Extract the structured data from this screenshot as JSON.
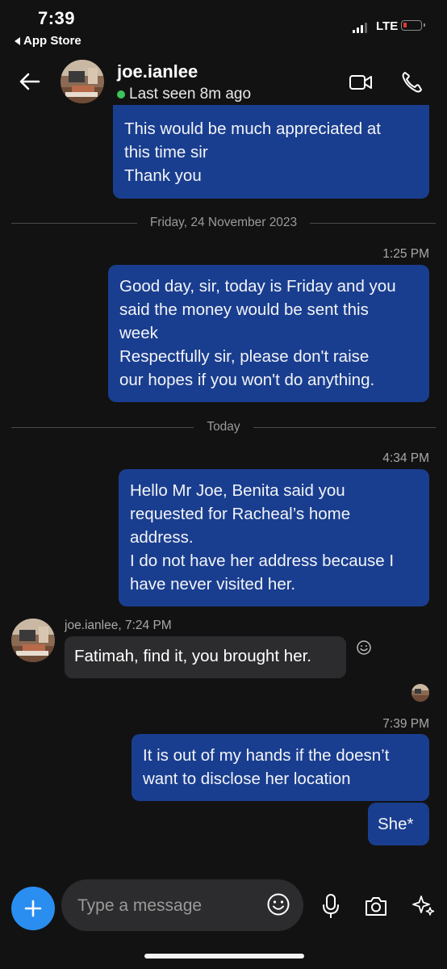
{
  "status_bar": {
    "time": "7:39",
    "back_app": "App Store",
    "network": "LTE",
    "battery_color": "#e53935"
  },
  "header": {
    "contact_name": "joe.ianlee",
    "presence": "Last seen 8m ago",
    "presence_color": "#3cc45a",
    "icons": [
      "back-arrow-icon",
      "video-call-icon",
      "phone-icon"
    ]
  },
  "messages": [
    {
      "direction": "outgoing",
      "lines": [
        "This would be much appreciated at",
        "this time sir",
        "Thank you"
      ]
    },
    {
      "type": "date_separator",
      "text": "Friday, 24 November 2023"
    },
    {
      "direction": "outgoing",
      "time": "1:25 PM",
      "lines": [
        "Good day, sir, today is Friday and you",
        "said the money would be sent this",
        "week",
        "Respectfully sir, please don't raise",
        "our hopes if you won't do anything."
      ]
    },
    {
      "type": "date_separator",
      "text": "Today"
    },
    {
      "direction": "outgoing",
      "time": "4:34 PM",
      "lines": [
        "Hello Mr Joe, Benita said you",
        "requested for Racheal’s home",
        "address.",
        "I do not have her address because I",
        "have never visited her."
      ]
    },
    {
      "direction": "incoming",
      "sender_line": "joe.ianlee, 7:24 PM",
      "lines": [
        "Fatimah, find it, you brought her."
      ]
    },
    {
      "direction": "outgoing",
      "time": "7:39 PM",
      "lines": [
        "It is out of my hands if the doesn’t",
        "want to disclose her location"
      ]
    },
    {
      "direction": "outgoing",
      "lines": [
        "She*"
      ]
    }
  ],
  "composer": {
    "placeholder": "Type a message",
    "icons": [
      "plus-icon",
      "emoji-icon",
      "microphone-icon",
      "camera-icon",
      "sparkle-icon"
    ]
  },
  "colors": {
    "background": "#121212",
    "outgoing_bubble": "#1a3e8f",
    "incoming_bubble": "#2c2c2e",
    "accent": "#2a8ef0"
  }
}
